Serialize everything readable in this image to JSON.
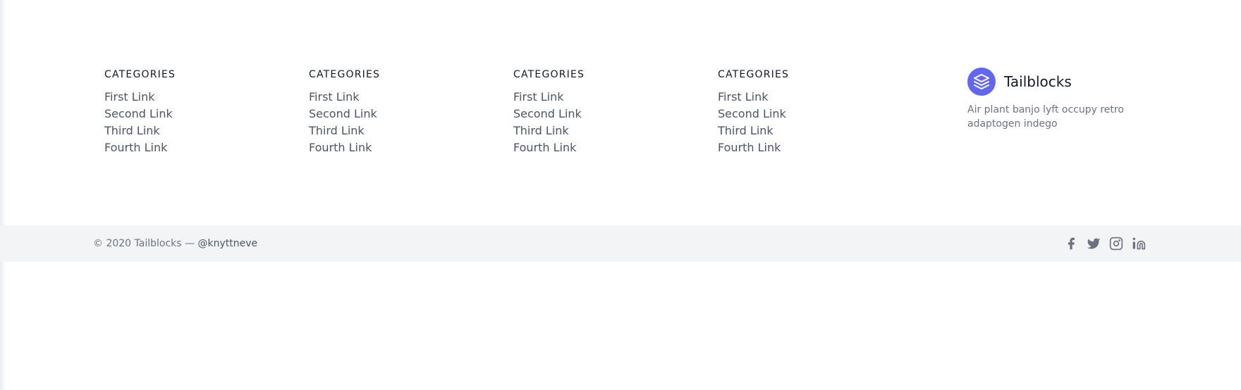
{
  "columns": [
    {
      "title": "CATEGORIES",
      "links": [
        "First Link",
        "Second Link",
        "Third Link",
        "Fourth Link"
      ]
    },
    {
      "title": "CATEGORIES",
      "links": [
        "First Link",
        "Second Link",
        "Third Link",
        "Fourth Link"
      ]
    },
    {
      "title": "CATEGORIES",
      "links": [
        "First Link",
        "Second Link",
        "Third Link",
        "Fourth Link"
      ]
    },
    {
      "title": "CATEGORIES",
      "links": [
        "First Link",
        "Second Link",
        "Third Link",
        "Fourth Link"
      ]
    }
  ],
  "brand": {
    "name": "Tailblocks",
    "description": "Air plant banjo lyft occupy retro adaptogen indego",
    "logo_icon": "layers-icon",
    "accent_color": "#6366f1"
  },
  "footer_bottom": {
    "copyright": "© 2020 Tailblocks —",
    "handle": "@knyttneve",
    "background": "#f3f4f6"
  },
  "social_icons": [
    "facebook-icon",
    "twitter-icon",
    "instagram-icon",
    "linkedin-icon"
  ]
}
